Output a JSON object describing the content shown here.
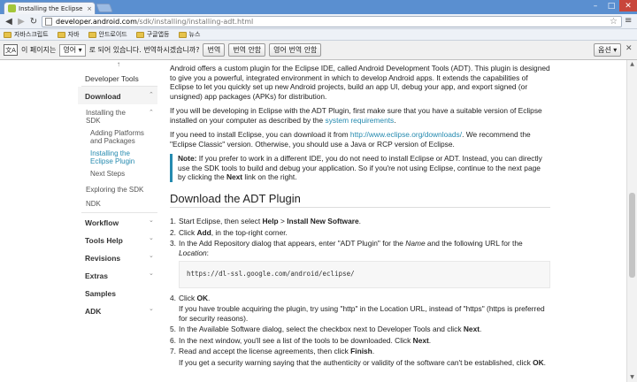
{
  "browser": {
    "tab_title": "Installing the Eclipse Plu",
    "tab_close": "×",
    "url_host": "developer.android.com",
    "url_path": "/sdk/installing/installing-adt.html",
    "star_icon": "☆",
    "wrench_icon": "🔧",
    "min_glyph": "–",
    "max_glyph": "□",
    "close_glyph": "✕",
    "back_glyph": "◀",
    "forward_glyph": "▶",
    "reload_glyph": "↻"
  },
  "bookmarks": [
    {
      "label": "자바스크립트"
    },
    {
      "label": "자바"
    },
    {
      "label": "안드로이드"
    },
    {
      "label": "구글앱등"
    },
    {
      "label": "뉴스"
    }
  ],
  "translate_bar": {
    "icon_text": "文A",
    "prefix": "이 페이지는",
    "language": "영어 ▾",
    "suffix": "로 되어 있습니다. 번역하시겠습니까?",
    "translate_button": "번역",
    "never_translate_page": "번역 안함",
    "never_translate_language": "영어 번역 안함",
    "options_button": "옵션 ▾",
    "close": "✕"
  },
  "sidebar": {
    "top_arrow": "↑",
    "developer_tools": "Developer Tools",
    "download": "Download",
    "installing_sdk_line1": "Installing the",
    "installing_sdk_line2": "SDK",
    "adding_platforms_line1": "Adding Platforms",
    "adding_platforms_line2": "and Packages",
    "installing_eclipse_line1": "Installing the",
    "installing_eclipse_line2": "Eclipse Plugin",
    "next_steps": "Next Steps",
    "exploring_sdk": "Exploring the SDK",
    "ndk": "NDK",
    "workflow": "Workflow",
    "tools_help": "Tools Help",
    "revisions": "Revisions",
    "extras": "Extras",
    "samples": "Samples",
    "adk": "ADK",
    "chevron_down": "⌄",
    "chevron_up": "⌃"
  },
  "content": {
    "p1": "Android offers a custom plugin for the Eclipse IDE, called Android Development Tools (ADT). This plugin is designed to give you a powerful, integrated environment in which to develop Android apps. It extends the capabilities of Eclipse to let you quickly set up new Android projects, build an app UI, debug your app, and export signed (or unsigned) app packages (APKs) for distribution.",
    "p2_a": "If you will be developing in Eclipse with the ADT Plugin, first make sure that you have a suitable version of Eclipse installed on your computer as described by the ",
    "p2_link": "system requirements",
    "p2_b": ".",
    "p3_a": "If you need to install Eclipse, you can download it from ",
    "p3_link": "http://www.eclipse.org/downloads/",
    "p3_b": ". We recommend the \"Eclipse Classic\" version. Otherwise, you should use a Java or RCP version of Eclipse.",
    "note_label": "Note:",
    "note_text_a": " If you prefer to work in a different IDE, you do not need to install Eclipse or ADT. Instead, you can directly use the SDK tools to build and debug your application. So if you're not using Eclipse, continue to the next page by clicking the ",
    "note_next": "Next",
    "note_text_b": " link on the right.",
    "heading": "Download the ADT Plugin",
    "s1_num": "1.",
    "s1_a": "Start Eclipse, then select ",
    "s1_help": "Help",
    "s1_gt": " > ",
    "s1_install": "Install New Software",
    "s1_b": ".",
    "s2_num": "2.",
    "s2_a": "Click ",
    "s2_add": "Add",
    "s2_b": ", in the top-right corner.",
    "s3_num": "3.",
    "s3_a": "In the Add Repository dialog that appears, enter \"ADT Plugin\" for the ",
    "s3_name": "Name",
    "s3_b": " and the following URL for the ",
    "s3_location": "Location",
    "s3_c": ":",
    "code_url": "https://dl-ssl.google.com/android/eclipse/",
    "s4_num": "4.",
    "s4_a": "Click ",
    "s4_ok": "OK",
    "s4_b": ".",
    "s4_sub": "If you have trouble acquiring the plugin, try using \"http\" in the Location URL, instead of \"https\" (https is preferred for security reasons).",
    "s5_num": "5.",
    "s5_a": "In the Available Software dialog, select the checkbox next to Developer Tools and click ",
    "s5_next": "Next",
    "s5_b": ".",
    "s6_num": "6.",
    "s6_a": "In the next window, you'll see a list of the tools to be downloaded. Click ",
    "s6_next": "Next",
    "s6_b": ".",
    "s7_num": "7.",
    "s7_a": "Read and accept the license agreements, then click ",
    "s7_finish": "Finish",
    "s7_b": ".",
    "s7_sub_a": "If you get a security warning saying that the authenticity or validity of the software can't be established, click ",
    "s7_sub_ok": "OK",
    "s7_sub_b": "."
  },
  "scrollbar": {
    "up": "▲",
    "down": "▼"
  }
}
